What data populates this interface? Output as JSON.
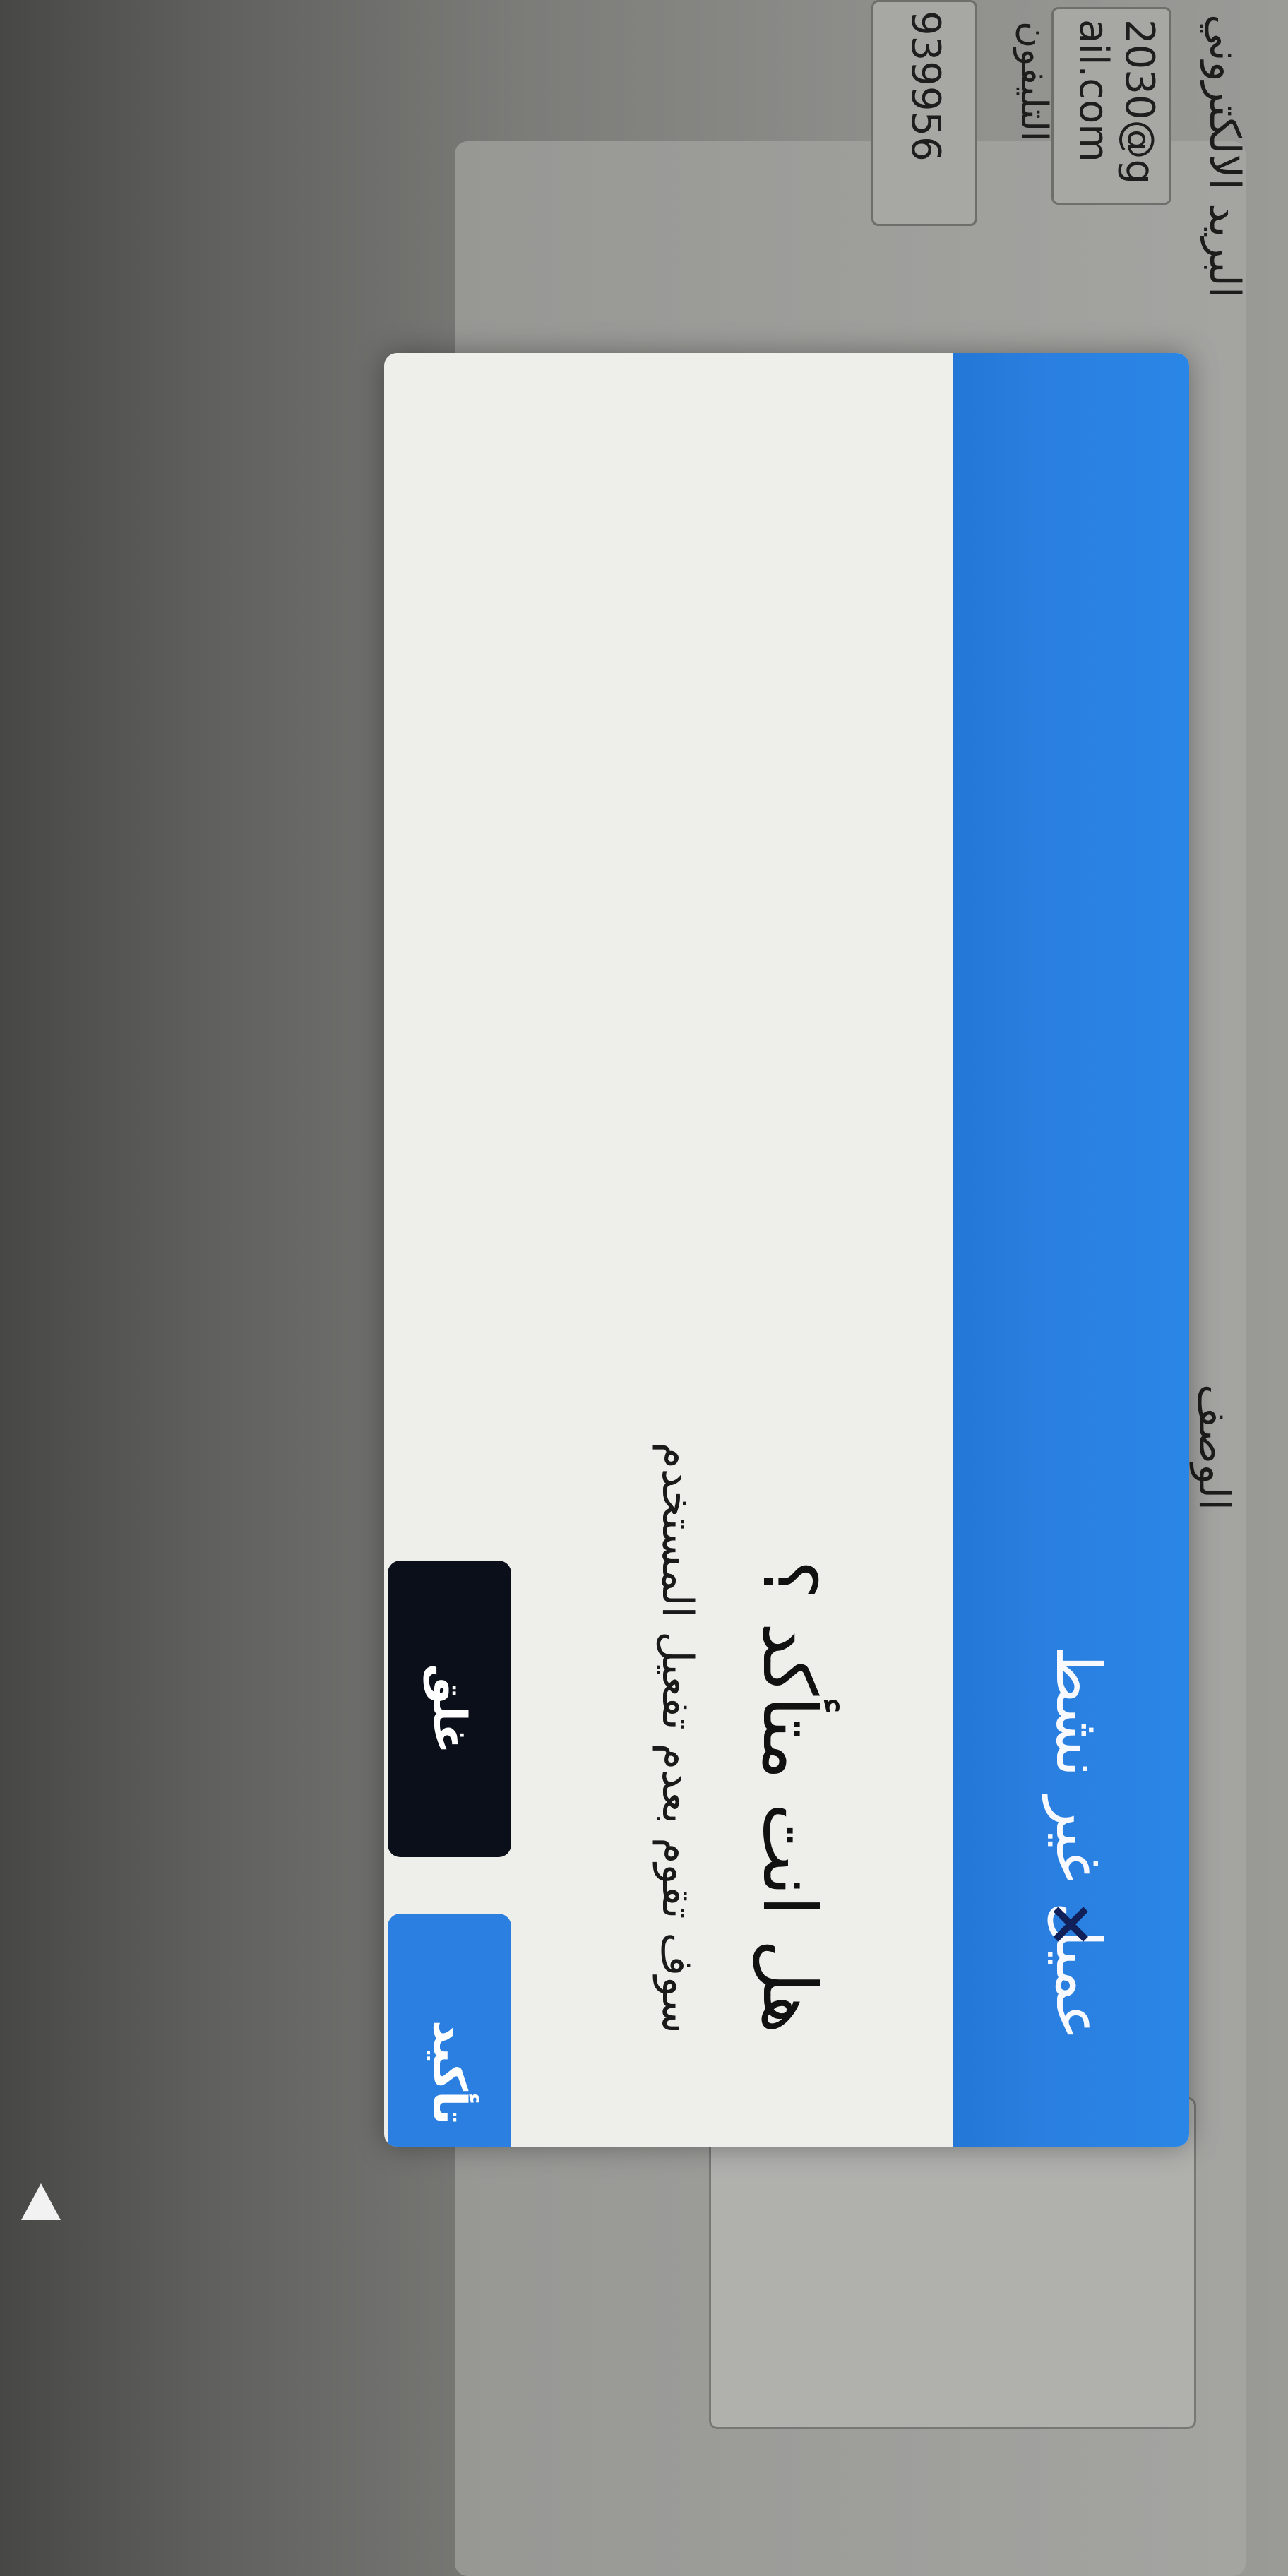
{
  "background": {
    "fields": {
      "description_label": "الوصف",
      "email_label": "البريد الالكتروني",
      "email_value_line1": "2030@g",
      "email_value_line2": "ail.com",
      "phone_label": "التليفون",
      "phone_value": "939956"
    }
  },
  "modal": {
    "title": "عميل غير نشط",
    "close_icon": "×",
    "question": "هل انت متأكد ؟",
    "description": "سوف تقوم بعدم تفعيل المستخدم",
    "buttons": {
      "confirm": "تأكيد",
      "close": "غلق"
    },
    "colors": {
      "header": "#2a7fe0",
      "confirm_button": "#2a7fe0",
      "close_button": "#0b0f1a"
    }
  }
}
